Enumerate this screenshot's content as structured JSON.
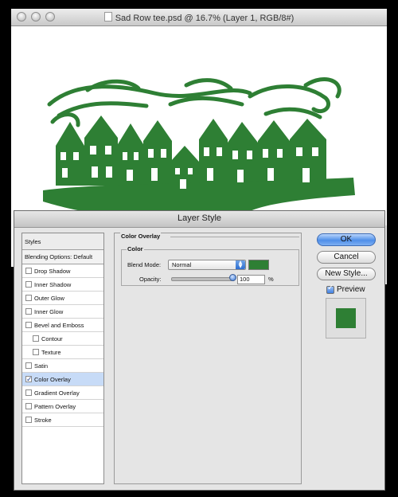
{
  "colors": {
    "overlay": "#2e7f34",
    "selection": "#c7dbf7",
    "accent": "#4f8fe9"
  },
  "document": {
    "title": "Sad Row tee.psd @ 16.7% (Layer 1, RGB/8#)",
    "artwork": "green-houses-linocut-icon"
  },
  "dialog": {
    "title": "Layer Style",
    "styles_header": "Styles",
    "blending_options": "Blending Options: Default",
    "items": [
      {
        "label": "Drop Shadow",
        "checked": false
      },
      {
        "label": "Inner Shadow",
        "checked": false
      },
      {
        "label": "Outer Glow",
        "checked": false
      },
      {
        "label": "Inner Glow",
        "checked": false
      },
      {
        "label": "Bevel and Emboss",
        "checked": false
      },
      {
        "label": "Contour",
        "checked": false
      },
      {
        "label": "Texture",
        "checked": false
      },
      {
        "label": "Satin",
        "checked": false
      },
      {
        "label": "Color Overlay",
        "checked": true
      },
      {
        "label": "Gradient Overlay",
        "checked": false
      },
      {
        "label": "Pattern Overlay",
        "checked": false
      },
      {
        "label": "Stroke",
        "checked": false
      }
    ],
    "panel": {
      "group_title": "Color Overlay",
      "subgroup_title": "Color",
      "blend_mode_label": "Blend Mode:",
      "blend_mode_value": "Normal",
      "opacity_label": "Opacity:",
      "opacity_value": "100",
      "opacity_unit": "%",
      "opacity_fraction": 1.0
    },
    "buttons": {
      "ok": "OK",
      "cancel": "Cancel",
      "new_style": "New Style..."
    },
    "preview_label": "Preview"
  }
}
